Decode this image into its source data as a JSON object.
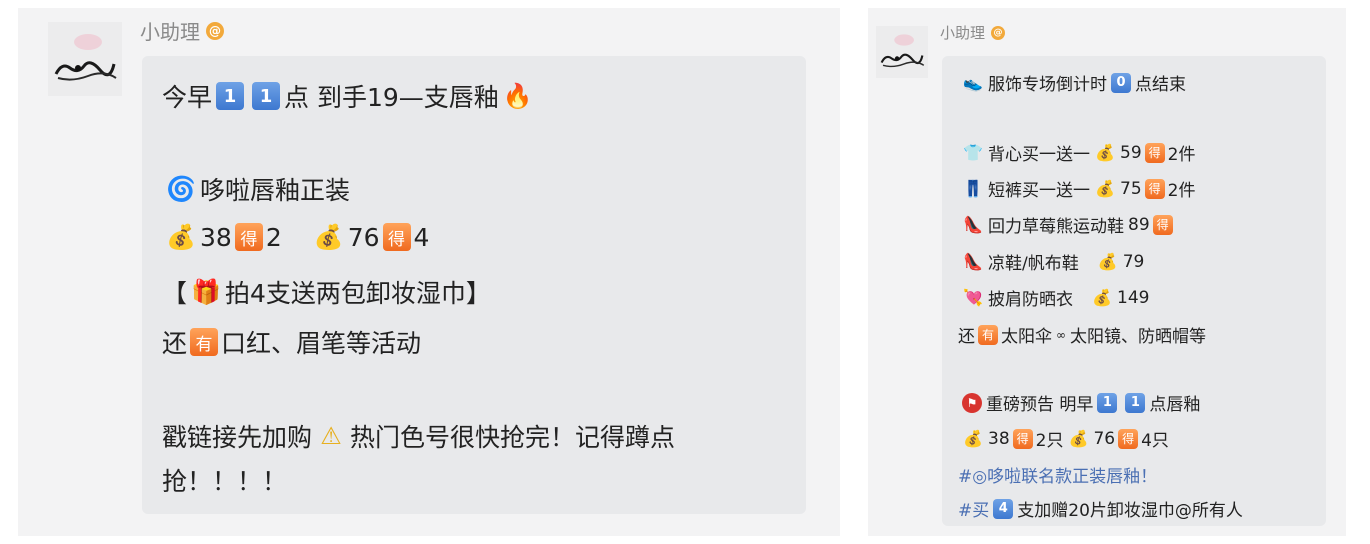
{
  "left_post": {
    "sender": "小助理",
    "verified_badge": "@",
    "line1": {
      "a": "今早",
      "k1": "1",
      "k2": "1",
      "b": "点 到手19—支唇釉",
      "icon": "fire-icon"
    },
    "line2": {
      "icon": "swirl-icon",
      "text": "哆啦唇釉正装"
    },
    "line3": {
      "p1": "38",
      "de1": "得",
      "n1": "2",
      "p2": "76",
      "de2": "得",
      "n2": "4"
    },
    "line4": {
      "open": "【",
      "icon": "gift-icon",
      "text": "拍4支送两包卸妆湿巾】"
    },
    "line5": {
      "a": "还",
      "you": "有",
      "b": "口红、眉笔等活动"
    },
    "line6": {
      "a": "戳链接先加购",
      "b": "热门色号很快抢完！记得蹲点"
    },
    "line7": {
      "text": "抢！！！！"
    }
  },
  "right_post": {
    "sender": "小助理",
    "verified_badge": "@",
    "header": {
      "a": "服饰专场倒计时",
      "k": "0",
      "b": "点结束"
    },
    "items": [
      {
        "icon": "tanktop-icon",
        "text": "背心买一送一",
        "price": "59",
        "de": "得",
        "qty": "2件"
      },
      {
        "icon": "shorts-icon",
        "text": "短裤买一送一",
        "price": "75",
        "de": "得",
        "qty": "2件"
      },
      {
        "icon": "shoe-icon",
        "text": "回力草莓熊运动鞋",
        "price": "89",
        "de": "得"
      },
      {
        "icon": "shoe-icon",
        "text": "凉鞋/帆布鞋",
        "price": "79"
      },
      {
        "icon": "heart-icon",
        "text": "披肩防晒衣",
        "price": "149"
      }
    ],
    "also": {
      "a": "还",
      "you": "有",
      "b": "太阳伞",
      "c": "太阳镜、防晒帽等"
    },
    "notice": {
      "a": "重磅预告 明早",
      "k1": "1",
      "k2": "1",
      "b": "点唇釉"
    },
    "price_line": {
      "p1": "38",
      "de1": "得",
      "n1": "2只",
      "p2": "76",
      "de2": "得",
      "n2": "4只"
    },
    "tag1": "#◎哆啦联名款正装唇釉！",
    "tag2": {
      "a": "#买",
      "k": "4",
      "b": "支加赠20片卸妆湿巾@所有人"
    }
  }
}
